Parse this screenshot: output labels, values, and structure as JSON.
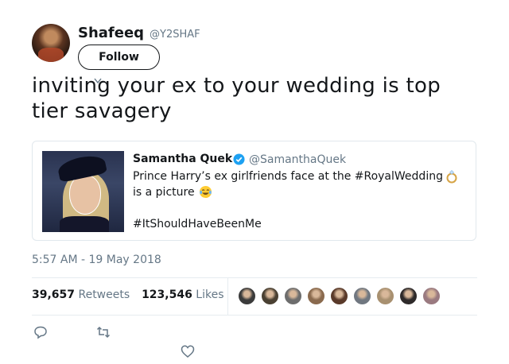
{
  "author": {
    "display_name": "Shafeeq",
    "handle": "@Y2SHAF",
    "follow_label": "Follow"
  },
  "tweet": {
    "text": "inviting your ex to your wedding is top tier savagery",
    "timestamp": "5:57 AM - 19 May 2018"
  },
  "quoted_tweet": {
    "display_name": "Samantha Quek",
    "handle": "@SamanthaQuek",
    "line1": "Prince Harry’s ex girlfriends face at the #RoyalWedding",
    "line2": "is a picture",
    "line3": "#ItShouldHaveBeenMe",
    "verified_color": "#1da1f2",
    "emoji": [
      "ring-icon",
      "laughing-crying-face-icon"
    ]
  },
  "stats": {
    "retweets_count": "39,657",
    "retweets_label": "Retweets",
    "likes_count": "123,546",
    "likes_label": "Likes"
  },
  "likers": [
    {
      "color": "#3b3b3b"
    },
    {
      "color": "#4a4032"
    },
    {
      "color": "#6d6d6d"
    },
    {
      "color": "#8a6a4e"
    },
    {
      "color": "#5a3a2a"
    },
    {
      "color": "#707780"
    },
    {
      "color": "#a89070"
    },
    {
      "color": "#2e2a2a"
    },
    {
      "color": "#9a7a80"
    }
  ],
  "actions": [
    "reply-icon",
    "retweet-icon",
    "like-icon"
  ],
  "colors": {
    "text": "#14171a",
    "muted": "#657786",
    "border": "#e1e8ed"
  }
}
